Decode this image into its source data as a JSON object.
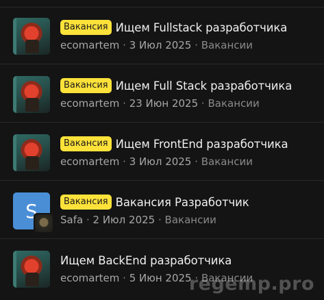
{
  "threads": [
    {
      "badge": "Вакансия",
      "title": "Ищем Fullstack разработчика",
      "author": "ecomartem",
      "date": "3 Июл 2025",
      "forum": "Вакансии",
      "avatar": "image"
    },
    {
      "badge": "Вакансия",
      "title": "Ищем Full Stack разработчика",
      "author": "ecomartem",
      "date": "23 Июн 2025",
      "forum": "Вакансии",
      "avatar": "image"
    },
    {
      "badge": "Вакансия",
      "title": "Ищем FrontEnd разработчика",
      "author": "ecomartem",
      "date": "3 Июл 2025",
      "forum": "Вакансии",
      "avatar": "image"
    },
    {
      "badge": "Вакансия",
      "title": "Вакансия Разработчик",
      "author": "Safa",
      "date": "2 Июл 2025",
      "forum": "Вакансии",
      "avatar": "letter",
      "avatar_letter": "S",
      "avatar_color": "#4a8fd6"
    },
    {
      "badge": "",
      "title": "Ищем BackEnd разработчика",
      "author": "ecomartem",
      "date": "5 Июн 2025",
      "forum": "Вакансии",
      "avatar": "image"
    }
  ],
  "separator": "·",
  "watermark": "regemp.pro",
  "colors": {
    "badge_bg": "#fde23a",
    "background": "#141414"
  }
}
